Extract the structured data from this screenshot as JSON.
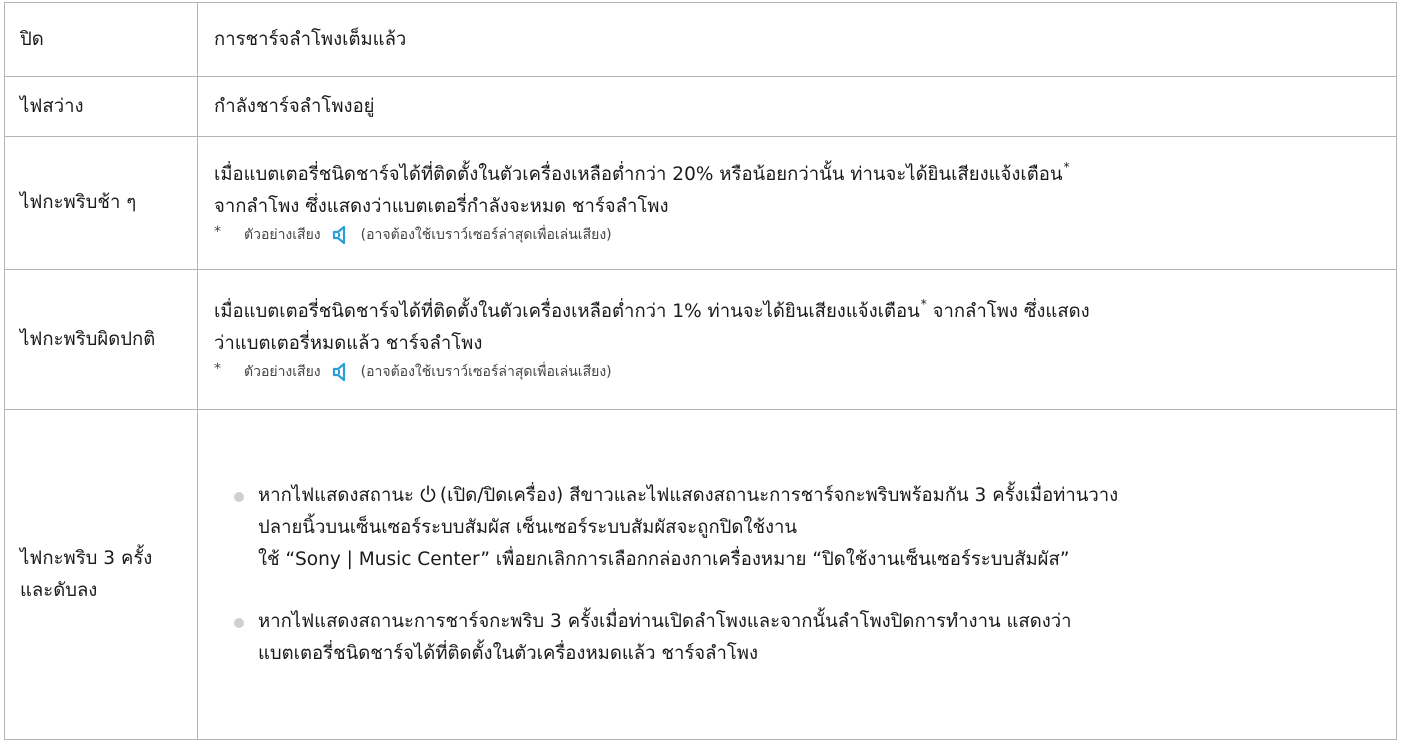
{
  "rows": [
    {
      "status": "ปิด",
      "description": "การชาร์จลำโพงเต็มแล้ว"
    },
    {
      "status": "ไฟสว่าง",
      "description": "กำลังชาร์จลำโพงอยู่"
    },
    {
      "status": "ไฟกะพริบช้า ๆ",
      "description_line1": "เมื่อแบตเตอรี่ชนิดชาร์จได้ที่ติดตั้งในตัวเครื่องเหลือต่ำกว่า 20% หรือน้อยกว่านั้น ท่านจะได้ยินเสียงแจ้งเตือน",
      "description_line2": "จากลำโพง ซึ่งแสดงว่าแบตเตอรี่กำลังจะหมด ชาร์จลำโพง",
      "note_prefix": "ตัวอย่างเสียง",
      "note_suffix": "(อาจต้องใช้เบราว์เซอร์ล่าสุดเพื่อเล่นเสียง)"
    },
    {
      "status": "ไฟกะพริบผิดปกติ",
      "description_line1": "เมื่อแบตเตอรี่ชนิดชาร์จได้ที่ติดตั้งในตัวเครื่องเหลือต่ำกว่า 1% ท่านจะได้ยินเสียงแจ้งเตือน",
      "description_line1_after": " จากลำโพง ซึ่งแสดง",
      "description_line2": "ว่าแบตเตอรี่หมดแล้ว ชาร์จลำโพง",
      "note_prefix": "ตัวอย่างเสียง",
      "note_suffix": "(อาจต้องใช้เบราว์เซอร์ล่าสุดเพื่อเล่นเสียง)"
    },
    {
      "status": "ไฟกะพริบ 3 ครั้งและดับลง",
      "bullet1_before_icon": "หากไฟแสดงสถานะ",
      "bullet1_after_icon": "(เปิด/ปิดเครื่อง) สีขาวและไฟแสดงสถานะการชาร์จกะพริบพร้อมกัน 3 ครั้งเมื่อท่านวาง",
      "bullet1_line2": "ปลายนิ้วบนเซ็นเซอร์ระบบสัมผัส เซ็นเซอร์ระบบสัมผัสจะถูกปิดใช้งาน",
      "bullet1_line3": "ใช้ “Sony | Music Center” เพื่อยกเลิกการเลือกกล่องกาเครื่องหมาย “ปิดใช้งานเซ็นเซอร์ระบบสัมผัส”",
      "bullet2_line1": "หากไฟแสดงสถานะการชาร์จกะพริบ 3 ครั้งเมื่อท่านเปิดลำโพงและจากนั้นลำโพงปิดการทำงาน แสดงว่า",
      "bullet2_line2": "แบตเตอรี่ชนิดชาร์จได้ที่ติดตั้งในตัวเครื่องหมดแล้ว ชาร์จลำโพง"
    }
  ],
  "marks": {
    "asterisk": "*"
  },
  "icons": {
    "speaker": "speaker-icon",
    "power": "power-icon"
  },
  "colors": {
    "speaker_icon": "#2a9fd6",
    "border": "#b5b5b5",
    "bullet": "#cfcfcf"
  }
}
